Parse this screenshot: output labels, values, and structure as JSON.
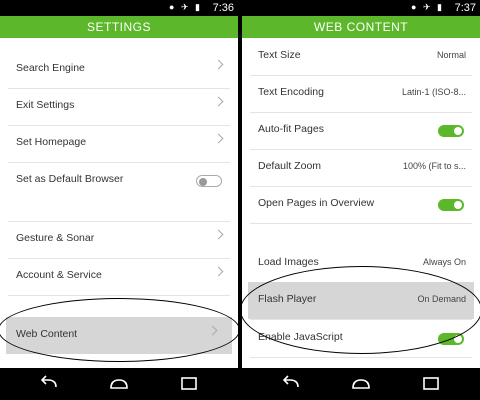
{
  "left": {
    "status": {
      "time": "7:36"
    },
    "title": "SETTINGS",
    "items": [
      {
        "label": "Search Engine"
      },
      {
        "label": "Exit Settings"
      },
      {
        "label": "Set Homepage"
      },
      {
        "label": "Set as Default Browser",
        "toggle": "off"
      },
      {
        "label": "Gesture & Sonar"
      },
      {
        "label": "Account & Service"
      },
      {
        "label": "Web Content",
        "selected": true
      }
    ]
  },
  "right": {
    "status": {
      "time": "7:37"
    },
    "title": "WEB CONTENT",
    "items": [
      {
        "label": "Text Size",
        "value": "Normal"
      },
      {
        "label": "Text Encoding",
        "value": "Latin-1 (ISO-8..."
      },
      {
        "label": "Auto-fit Pages",
        "toggle": "on"
      },
      {
        "label": "Default Zoom",
        "value": "100% (Fit to s..."
      },
      {
        "label": "Open Pages in Overview",
        "toggle": "on"
      },
      {
        "label": "Load Images",
        "value": "Always On"
      },
      {
        "label": "Flash Player",
        "value": "On Demand",
        "selected": true
      },
      {
        "label": "Enable JavaScript",
        "toggle": "on"
      }
    ]
  },
  "colors": {
    "accent": "#5cb82a",
    "highlight": "#d6d6d6"
  },
  "icons": {
    "status": [
      "wifi-icon",
      "airplane-icon",
      "battery-icon"
    ],
    "nav": [
      "back-icon",
      "home-icon",
      "recents-icon"
    ]
  }
}
